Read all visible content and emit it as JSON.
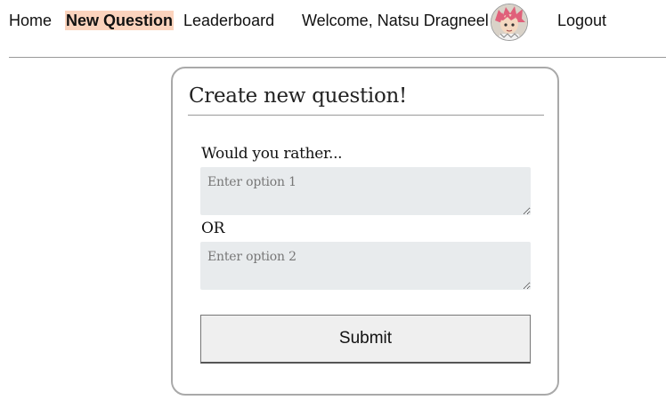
{
  "nav": {
    "home_label": "Home",
    "new_question_label": "New Question",
    "leaderboard_label": "Leaderboard",
    "welcome_text": "Welcome, Natsu Dragneel",
    "logout_label": "Logout",
    "active_item": "New Question",
    "active_highlight_color": "#fbd3bd",
    "avatar_icon": "user-avatar-icon"
  },
  "form": {
    "title": "Create new question!",
    "prompt": "Would you rather...",
    "option1_placeholder": "Enter option 1",
    "option1_value": "",
    "separator": "OR",
    "option2_placeholder": "Enter option 2",
    "option2_value": "",
    "submit_label": "Submit"
  }
}
